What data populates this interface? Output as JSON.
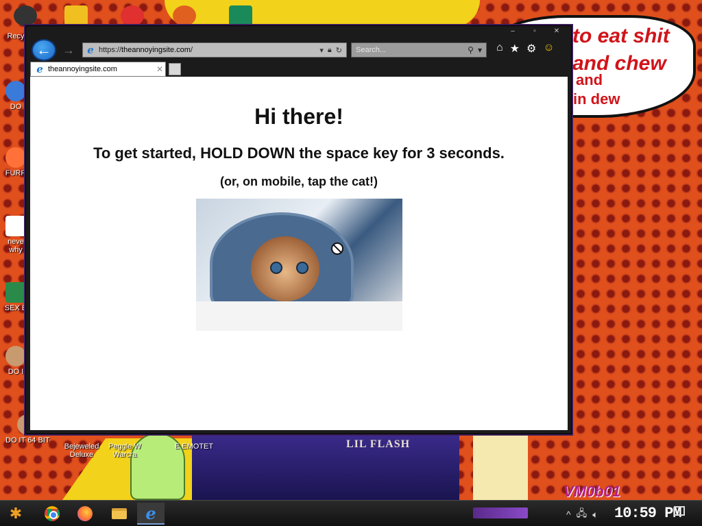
{
  "desktop": {
    "speech_bubble": {
      "line1": "to eat shit",
      "line2": "and chew",
      "line3": "and",
      "line4": "in dew"
    },
    "icons_left": [
      {
        "label": "Recy",
        "icon": "recycle-bin-icon"
      },
      {
        "label": "DO",
        "icon": "chrome-icon"
      },
      {
        "label": "FURR",
        "icon": "firefox-icon"
      },
      {
        "label": "neve\nwhy",
        "icon": "dc-icon"
      },
      {
        "label": "SEX E",
        "icon": "h-icon"
      },
      {
        "label": "DO I",
        "icon": "portrait-icon"
      },
      {
        "label": "DO IT 64 BIT",
        "icon": "portrait-icon"
      }
    ],
    "icons_bottom": [
      {
        "label": "Bejeweled\nDeluxe",
        "icon": "bejeweled-icon"
      },
      {
        "label": "Peggle W\nWarcra",
        "icon": "peggle-icon"
      },
      {
        "label": "E EMOTET",
        "icon": "emotet-icon"
      }
    ],
    "poster_title": "LIL FLASH",
    "vm_tag": "VM0b01"
  },
  "browser": {
    "url_prefix": "https://",
    "url_host": "theannoyingsite.com",
    "url_suffix": "/",
    "search_placeholder": "Search...",
    "tab_title": "theannoyingsite.com",
    "window_controls": [
      "–",
      "▫",
      "✕"
    ]
  },
  "page": {
    "heading": "Hi there!",
    "instruction": "To get started, HOLD DOWN the space key for 3 seconds.",
    "mobile_note": "(or, on mobile, tap the cat!)"
  },
  "taskbar": {
    "apps": [
      "chrome-icon",
      "firefox-icon",
      "file-explorer-icon",
      "internet-explorer-icon"
    ],
    "active_app": "internet-explorer-icon",
    "clock": "10:59 PM"
  }
}
